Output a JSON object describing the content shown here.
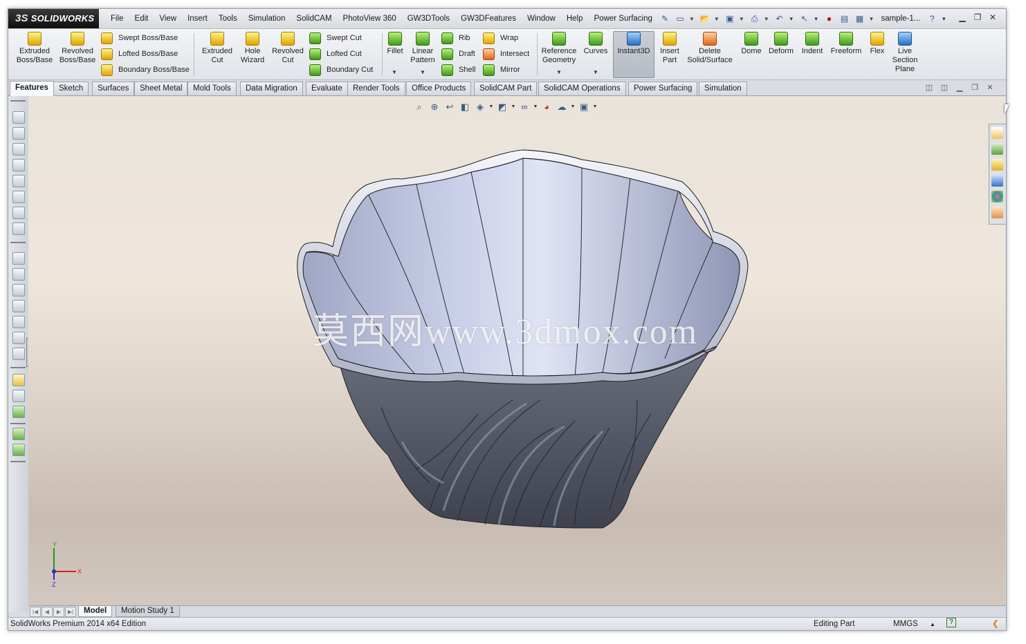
{
  "app": {
    "logo_ds": "3S",
    "logo_text": "SOLIDWORKS",
    "document_name": "sample-1..."
  },
  "menu": [
    "File",
    "Edit",
    "View",
    "Insert",
    "Tools",
    "Simulation",
    "SolidCAM",
    "PhotoView 360",
    "GW3DTools",
    "GW3DFeatures",
    "Window",
    "Help",
    "Power Surfacing"
  ],
  "ribbon": {
    "extruded_boss": [
      "Extruded",
      "Boss/Base"
    ],
    "revolved_boss": [
      "Revolved",
      "Boss/Base"
    ],
    "swept_boss": "Swept Boss/Base",
    "lofted_boss": "Lofted Boss/Base",
    "boundary_boss": "Boundary Boss/Base",
    "extruded_cut": [
      "Extruded",
      "Cut"
    ],
    "hole_wizard": [
      "Hole",
      "Wizard"
    ],
    "revolved_cut": [
      "Revolved",
      "Cut"
    ],
    "swept_cut": "Swept Cut",
    "lofted_cut": "Lofted Cut",
    "boundary_cut": "Boundary Cut",
    "fillet": "Fillet",
    "linear_pattern": [
      "Linear",
      "Pattern"
    ],
    "rib": "Rib",
    "draft": "Draft",
    "shell": "Shell",
    "wrap": "Wrap",
    "intersect": "Intersect",
    "mirror": "Mirror",
    "reference_geometry": [
      "Reference",
      "Geometry"
    ],
    "curves": "Curves",
    "instant3d": "Instant3D",
    "insert_part": [
      "Insert",
      "Part"
    ],
    "delete_solid": [
      "Delete",
      "Solid/Surface"
    ],
    "dome": "Dome",
    "deform": "Deform",
    "indent": "Indent",
    "freeform": "Freeform",
    "flex": "Flex",
    "live_section": [
      "Live",
      "Section",
      "Plane"
    ]
  },
  "command_tabs": [
    "Features",
    "Sketch",
    "Surfaces",
    "Sheet Metal",
    "Mold Tools",
    "Data Migration",
    "Evaluate",
    "Render Tools",
    "Office Products",
    "SolidCAM Part",
    "SolidCAM Operations",
    "Power Surfacing",
    "Simulation"
  ],
  "active_tab": "Features",
  "viewport": {
    "watermark": "莫西网www.3dmox.com",
    "triad_x": "X",
    "triad_y": "Y",
    "triad_z": "Z"
  },
  "bottom_tabs": [
    "Model",
    "Motion Study 1"
  ],
  "status": {
    "product": "SolidWorks Premium 2014 x64 Edition",
    "mode": "Editing Part",
    "units": "MMGS",
    "help": "?"
  },
  "colors": {
    "accent": "#c41f25",
    "viewport_top": "#e9e3da",
    "viewport_bottom": "#c8bcb2",
    "model_body": "#5a5f6c",
    "model_inside": "#bcc2dd"
  }
}
